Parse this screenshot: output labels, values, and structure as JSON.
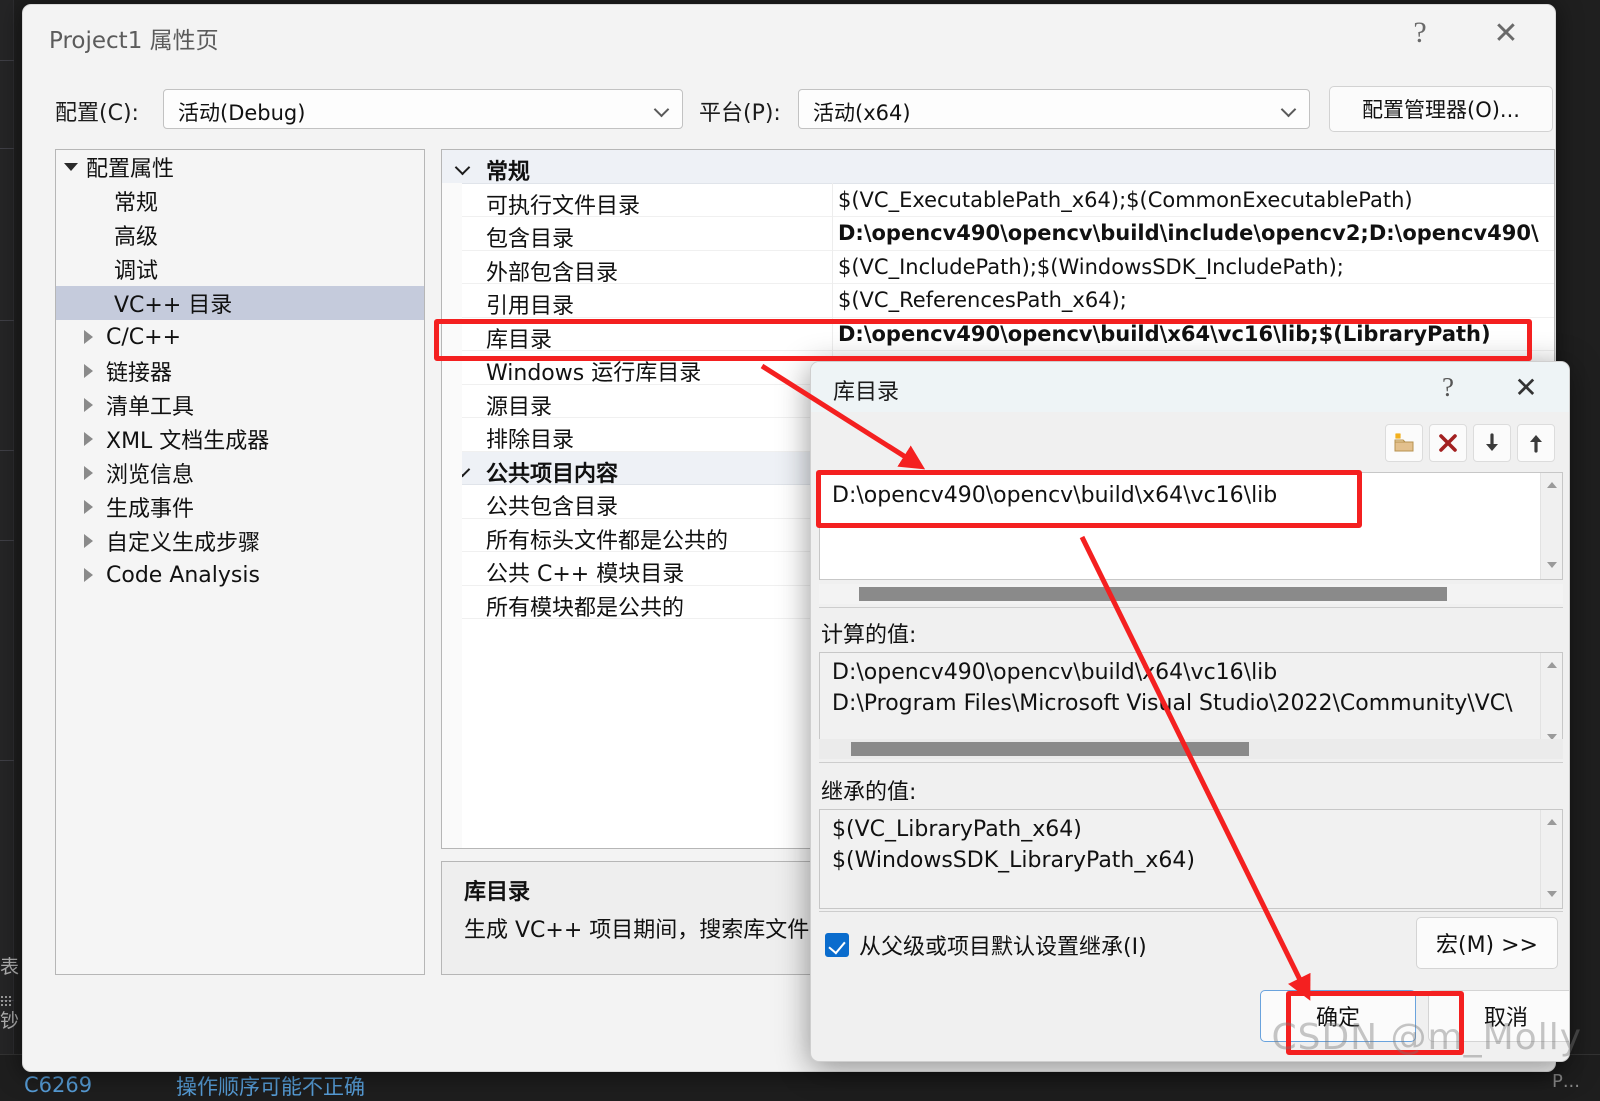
{
  "window": {
    "title": "Project1 属性页",
    "help_icon": "?",
    "close_icon": "✕"
  },
  "config_bar": {
    "config_label": "配置(C):",
    "config_value": "活动(Debug)",
    "platform_label": "平台(P):",
    "platform_value": "活动(x64)",
    "config_manager_button": "配置管理器(O)..."
  },
  "tree": {
    "root": "配置属性",
    "items": [
      {
        "label": "常规",
        "indent": "child",
        "expandable": false,
        "selected": false
      },
      {
        "label": "高级",
        "indent": "child",
        "expandable": false,
        "selected": false
      },
      {
        "label": "调试",
        "indent": "child",
        "expandable": false,
        "selected": false
      },
      {
        "label": "VC++ 目录",
        "indent": "child",
        "expandable": false,
        "selected": true
      },
      {
        "label": "C/C++",
        "indent": "grp",
        "expandable": true,
        "selected": false
      },
      {
        "label": "链接器",
        "indent": "grp",
        "expandable": true,
        "selected": false
      },
      {
        "label": "清单工具",
        "indent": "grp",
        "expandable": true,
        "selected": false
      },
      {
        "label": "XML 文档生成器",
        "indent": "grp",
        "expandable": true,
        "selected": false
      },
      {
        "label": "浏览信息",
        "indent": "grp",
        "expandable": true,
        "selected": false
      },
      {
        "label": "生成事件",
        "indent": "grp",
        "expandable": true,
        "selected": false
      },
      {
        "label": "自定义生成步骤",
        "indent": "grp",
        "expandable": true,
        "selected": false
      },
      {
        "label": "Code Analysis",
        "indent": "grp",
        "expandable": true,
        "selected": false
      }
    ]
  },
  "grid": {
    "rows": [
      {
        "kind": "category",
        "name": "常规"
      },
      {
        "kind": "property",
        "name": "可执行文件目录",
        "value": "$(VC_ExecutablePath_x64);$(CommonExecutablePath)",
        "bold": false
      },
      {
        "kind": "property",
        "name": "包含目录",
        "value": "D:\\opencv490\\opencv\\build\\include\\opencv2;D:\\opencv490\\",
        "bold": true
      },
      {
        "kind": "property",
        "name": "外部包含目录",
        "value": "$(VC_IncludePath);$(WindowsSDK_IncludePath);",
        "bold": false
      },
      {
        "kind": "property",
        "name": "引用目录",
        "value": "$(VC_ReferencesPath_x64);",
        "bold": false
      },
      {
        "kind": "property",
        "name": "库目录",
        "value": "D:\\opencv490\\opencv\\build\\x64\\vc16\\lib;$(LibraryPath)",
        "bold": true
      },
      {
        "kind": "property",
        "name": "Windows 运行库目录",
        "value": "",
        "bold": false
      },
      {
        "kind": "property",
        "name": "源目录",
        "value": "",
        "bold": false
      },
      {
        "kind": "property",
        "name": "排除目录",
        "value": "",
        "bold": false
      },
      {
        "kind": "category",
        "name": "公共项目内容"
      },
      {
        "kind": "property",
        "name": "公共包含目录",
        "value": "",
        "bold": false
      },
      {
        "kind": "property",
        "name": "所有标头文件都是公共的",
        "value": "",
        "bold": false
      },
      {
        "kind": "property",
        "name": "公共 C++ 模块目录",
        "value": "",
        "bold": false
      },
      {
        "kind": "property",
        "name": "所有模块都是公共的",
        "value": "",
        "bold": false
      }
    ]
  },
  "description": {
    "title": "库目录",
    "body": "生成 VC++ 项目期间，搜索库文件时"
  },
  "dialog": {
    "title": "库目录",
    "help_icon": "?",
    "close_icon": "✕",
    "toolbar": [
      {
        "name": "new-folder-icon"
      },
      {
        "name": "delete-icon"
      },
      {
        "name": "move-down-icon"
      },
      {
        "name": "move-up-icon"
      }
    ],
    "list_value": "D:\\opencv490\\opencv\\build\\x64\\vc16\\lib",
    "computed_label": "计算的值:",
    "computed_values": [
      "D:\\opencv490\\opencv\\build\\x64\\vc16\\lib",
      "D:\\Program Files\\Microsoft Visual Studio\\2022\\Community\\VC\\"
    ],
    "inherited_label": "继承的值:",
    "inherited_values": [
      "$(VC_LibraryPath_x64)",
      "$(WindowsSDK_LibraryPath_x64)"
    ],
    "inherit_checkbox_label": "从父级或项目默认设置继承(I)",
    "inherit_checked": true,
    "macro_button": "宏(M) >>",
    "ok_button": "确定",
    "cancel_button": "取消"
  },
  "ide_backdrop": {
    "error_code": "C6269",
    "error_message": "操作顺序可能不正确",
    "right_hint": "Р...",
    "side_text_1": "表",
    "side_text_2": "钞"
  },
  "watermark": "CSDN @m_Molly",
  "colors": {
    "annotation_red": "#f42020",
    "selection": "#c5cbdc",
    "category_bg": "#eef1f6",
    "accent_blue": "#0a6ccd",
    "dialog_title_bg": "#eef4f6"
  }
}
